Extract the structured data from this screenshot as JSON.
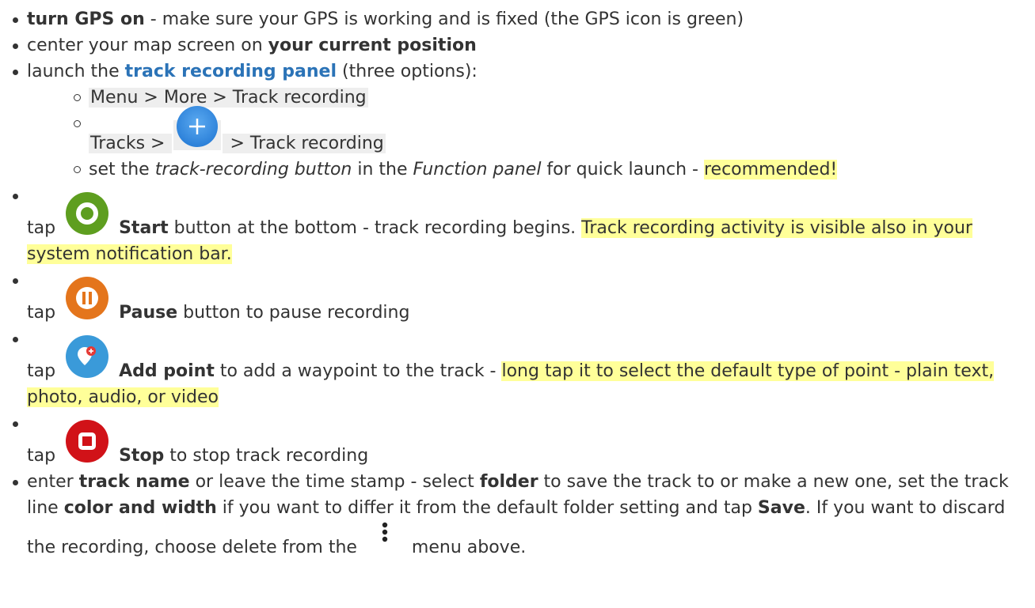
{
  "colors": {
    "text": "#333333",
    "link": "#2b73b7",
    "highlight": "#ffff99",
    "path_background": "#eeeeee",
    "start_icon": "#5e9e1f",
    "pause_icon": "#e4751c",
    "add_point_icon": "#3a9ad9",
    "stop_icon": "#d11218",
    "plus_icon": "#3b8fe0"
  },
  "items": {
    "gps": {
      "bold": "turn GPS on",
      "rest": " - make sure your GPS is working and is fixed (the GPS icon is green)"
    },
    "center": {
      "text": "center your map screen on ",
      "bold": "your current position"
    },
    "launch": {
      "text": "launch the ",
      "link": "track recording panel",
      "rest": " (three options):",
      "sub1": "Menu > More > Track recording",
      "sub2_before": "Tracks > ",
      "sub2_after": " > Track recording",
      "sub3_a": "set the ",
      "sub3_italic1": "track-recording button",
      "sub3_b": " in the ",
      "sub3_italic2": "Function panel",
      "sub3_c": " for quick launch - ",
      "sub3_highlight": "recommended!"
    },
    "start": {
      "tap": "tap",
      "bold": "Start",
      "rest": " button at the bottom - track recording begins. ",
      "highlight": "Track recording activity is visible also in your system notification bar."
    },
    "pause": {
      "tap": "tap",
      "bold": "Pause",
      "rest": " button to pause recording"
    },
    "add_point": {
      "tap": "tap",
      "bold": "Add point",
      "rest": " to add a waypoint to the track - ",
      "highlight": "long tap it to select the default type of point - plain text, photo, audio, or video"
    },
    "stop": {
      "tap": "tap",
      "bold": "Stop",
      "rest": " to stop track recording"
    },
    "save": {
      "a": "enter ",
      "bold1": "track name",
      "b": " or leave the time stamp - select ",
      "bold2": "folder",
      "c": " to save the track to or make a new one, set the track line ",
      "bold3": "color and width",
      "d": " if you want to differ it from the default folder setting and tap ",
      "bold4": "Save",
      "e": ". If you want to discard the recording, choose delete from the ",
      "f": "menu above."
    }
  }
}
